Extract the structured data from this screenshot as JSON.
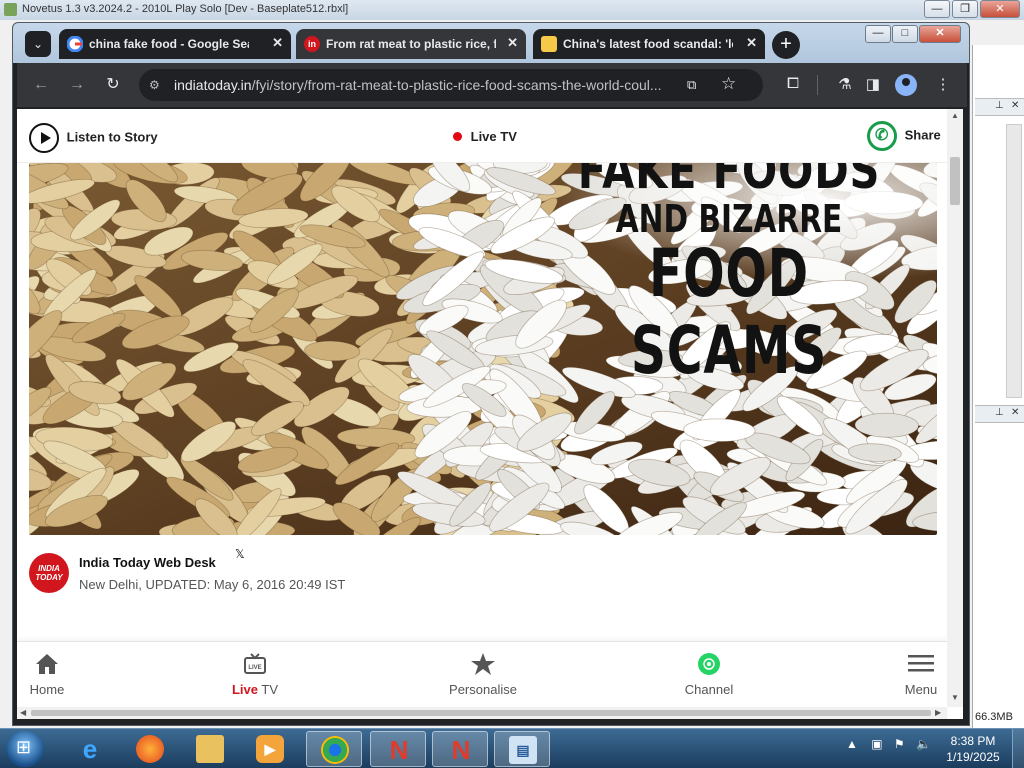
{
  "background_app": {
    "title": "Novetus 1.3 v3.2024.2 - 2010L Play Solo [Dev - Baseplate512.rbxl]",
    "memory": "66.3MB"
  },
  "browser": {
    "tabs": [
      {
        "title": "china fake food - Google Searc",
        "favicon_color": "#ffffff",
        "active": false
      },
      {
        "title": "From rat meat to plastic rice, fr",
        "favicon_color": "#d2161e",
        "active": true
      },
      {
        "title": "China's latest food scandal: 'le",
        "favicon_color": "#f7c948",
        "active": false
      }
    ],
    "url_domain": "indiatoday.in",
    "url_path": "/fyi/story/from-rat-meat-to-plastic-rice-food-scams-the-world-coul...",
    "window_controls": {
      "minimize": "—",
      "maximize": "□",
      "close": "✕"
    }
  },
  "page": {
    "listen_label": "Listen to Story",
    "live_tv_label": "Live TV",
    "share_label": "Share",
    "hero": {
      "line1": "FAKE FOODS",
      "line2": "AND BIZARRE",
      "line3": "FOOD SCAMS"
    },
    "author": {
      "logo_text": "INDIA TODAY",
      "name": "India Today Web Desk",
      "meta": "New Delhi, UPDATED: May 6, 2016 20:49 IST"
    },
    "bottom_nav": {
      "home": "Home",
      "live_prefix": "Live",
      "live_suffix": " TV",
      "personalise": "Personalise",
      "channel": "Channel",
      "menu": "Menu"
    }
  },
  "taskbar": {
    "time": "8:38 PM",
    "date": "1/19/2025"
  },
  "colors": {
    "brand_red": "#d2161e",
    "whatsapp_green": "#1b9c4b",
    "chrome_dark": "#35363a"
  }
}
